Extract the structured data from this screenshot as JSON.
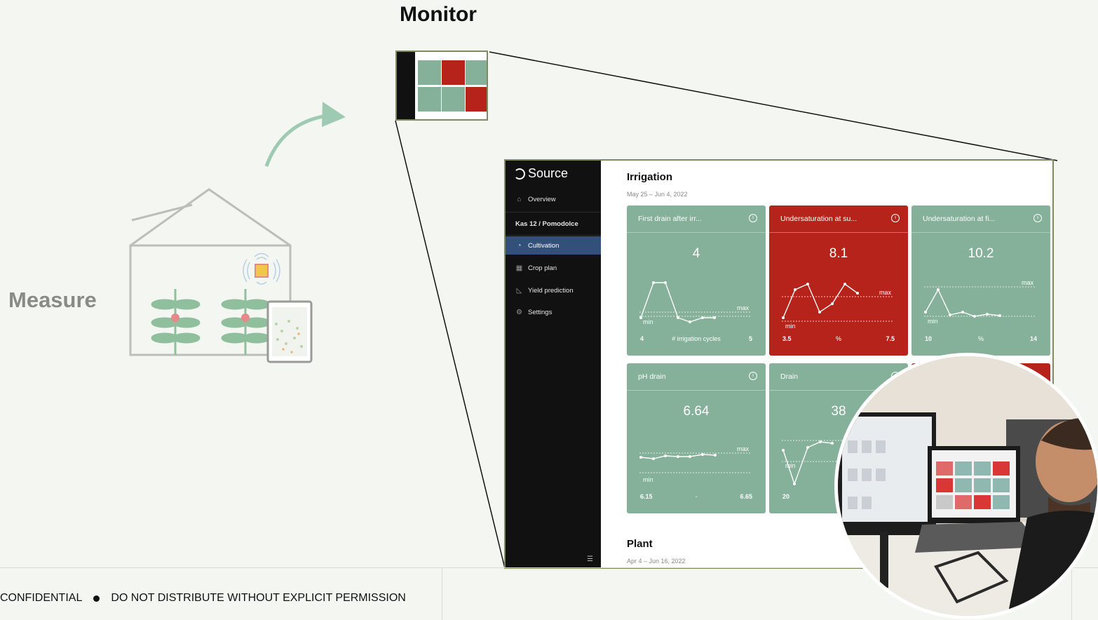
{
  "headings": {
    "monitor": "Monitor",
    "measure": "Measure"
  },
  "app": {
    "brand": "Source",
    "nav": {
      "overview": "Overview",
      "location": "Kas 12 / Pomodolce",
      "cultivation": "Cultivation",
      "crop_plan": "Crop plan",
      "yield_prediction": "Yield prediction",
      "settings": "Settings"
    },
    "irrigation": {
      "title": "Irrigation",
      "date_range": "May 25 – Jun 4, 2022",
      "cards": [
        {
          "title": "First drain after irr...",
          "value": "4",
          "status": "green",
          "min": "4",
          "unit": "# irrigation cycles",
          "max": "5",
          "max_label": "max",
          "min_label": "min"
        },
        {
          "title": "Undersaturation at su...",
          "value": "8.1",
          "status": "red",
          "min": "3.5",
          "unit": "%",
          "max": "7.5",
          "max_label": "max",
          "min_label": "min"
        },
        {
          "title": "Undersaturation at fi...",
          "value": "10.2",
          "status": "green",
          "min": "10",
          "unit": "%",
          "max": "14",
          "max_label": "max",
          "min_label": "min"
        },
        {
          "title": "pH drain",
          "value": "6.64",
          "status": "green",
          "min": "6.15",
          "unit": "-",
          "max": "6.65",
          "max_label": "max",
          "min_label": "min"
        },
        {
          "title": "Drain",
          "value": "38",
          "status": "green",
          "min": "20",
          "unit": "",
          "max": "",
          "max_label": "",
          "min_label": "min"
        }
      ]
    },
    "plant": {
      "title": "Plant",
      "date_range": "Apr 4 – Jun 16, 2022"
    }
  },
  "footer": {
    "confidential": "CONFIDENTIAL",
    "notice": "DO NOT DISTRIBUTE WITHOUT EXPLICIT PERMISSION"
  },
  "colors": {
    "green_card": "#85b09a",
    "red_card": "#b5231a",
    "sidebar": "#111111",
    "active_nav": "#33507a",
    "frame": "#7d8a62",
    "arrow": "#9fcab2"
  },
  "icons": [
    "home-icon",
    "gauge-icon",
    "grid-icon",
    "chart-icon",
    "gear-icon",
    "info-icon",
    "menu-icon"
  ]
}
